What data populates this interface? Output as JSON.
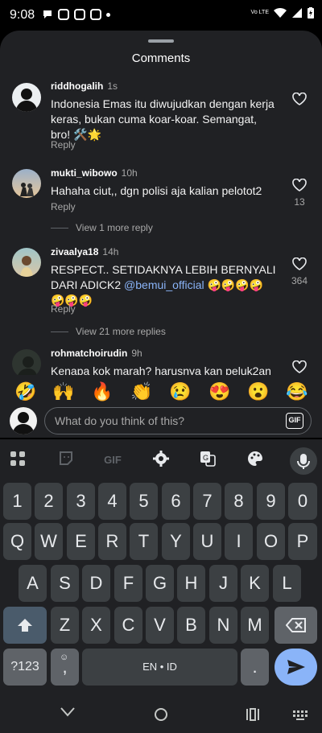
{
  "status_bar": {
    "time": "9:08",
    "network": "Vo LTE"
  },
  "sheet": {
    "title": "Comments",
    "comments": [
      {
        "user": "riddhogalih",
        "time": "1s",
        "text": "Indonesia Emas itu diwujudkan dengan kerja keras, bukan cuma koar-koar. Semangat, bro! 🛠️🌟",
        "reply": "Reply",
        "likes": ""
      },
      {
        "user": "mukti_wibowo",
        "time": "10h",
        "text": "Hahaha ciut,, dgn polisi aja kalian pelotot2",
        "reply": "Reply",
        "likes": "13",
        "view_more": "View 1 more reply"
      },
      {
        "user": "zivaalya18",
        "time": "14h",
        "text_before": "RESPECT.. SETIDAKNYA LEBIH BERNYALI DARI ADICK2 ",
        "mention": "@bemui_official",
        "text_after": " 🤪🤪🤪🤪🤪🤪🤪",
        "reply": "Reply",
        "likes": "364",
        "view_more": "View 21 more replies"
      },
      {
        "user": "rohmatchoirudin",
        "time": "9h",
        "text": "Kenapa kok marah? harusnya kan peluk2an"
      }
    ]
  },
  "emojis": [
    "🤣",
    "🙌",
    "🔥",
    "👏",
    "😢",
    "😍",
    "😮",
    "😂"
  ],
  "composer": {
    "placeholder": "What do you think of this?",
    "gif_label": "GIF"
  },
  "keyboard": {
    "toolbar": {
      "gif_label": "GIF"
    },
    "row_numbers": [
      "1",
      "2",
      "3",
      "4",
      "5",
      "6",
      "7",
      "8",
      "9",
      "0"
    ],
    "row_1": [
      "Q",
      "W",
      "E",
      "R",
      "T",
      "Y",
      "U",
      "I",
      "O",
      "P"
    ],
    "row_2": [
      "A",
      "S",
      "D",
      "F",
      "G",
      "H",
      "J",
      "K",
      "L"
    ],
    "row_3": [
      "Z",
      "X",
      "C",
      "V",
      "B",
      "N",
      "M"
    ],
    "symbols_label": "?123",
    "comma": ",",
    "space_label": "EN • ID",
    "period": "."
  }
}
